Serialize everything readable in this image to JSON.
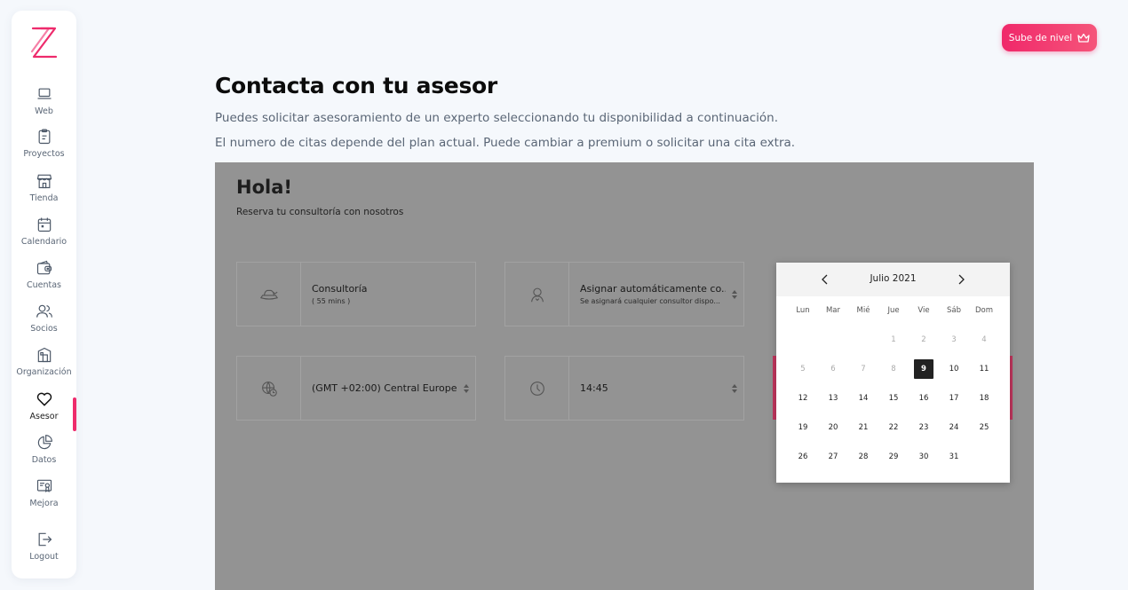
{
  "sidebar": {
    "items": [
      {
        "label": "Web",
        "icon": "laptop-icon"
      },
      {
        "label": "Proyectos",
        "icon": "clipboard-icon"
      },
      {
        "label": "Tienda",
        "icon": "store-icon"
      },
      {
        "label": "Calendario",
        "icon": "calendar-icon"
      },
      {
        "label": "Cuentas",
        "icon": "wallet-icon"
      },
      {
        "label": "Socios",
        "icon": "users-icon"
      },
      {
        "label": "Organización",
        "icon": "building-icon"
      },
      {
        "label": "Asesor",
        "icon": "heart-icon"
      },
      {
        "label": "Datos",
        "icon": "pie-chart-icon"
      },
      {
        "label": "Mejora",
        "icon": "certificate-icon"
      },
      {
        "label": "Logout",
        "icon": "logout-icon"
      }
    ],
    "active": "Asesor",
    "accent_color": "#ee2b6c"
  },
  "upgrade_button": {
    "label": "Sube de nivel",
    "icon": "crown-icon"
  },
  "header": {
    "title": "Contacta con tu asesor",
    "description_1": "Puedes solicitar asesoramiento de un experto seleccionando tu disponibilidad a continuación.",
    "description_2": "El numero de citas depende del plan actual. Puede cambiar a premium o solicitar una cita extra."
  },
  "booking": {
    "greeting": "Hola!",
    "subtitle": "Reserva tu consultoría con nosotros",
    "service": {
      "title": "Consultoría",
      "duration": "( 55 mins )",
      "icon": "hat-icon"
    },
    "consultant": {
      "title": "Asignar automáticamente co...",
      "subtitle": "Se asignará cualquier consultor dispo...",
      "icon": "person-icon"
    },
    "timezone": {
      "value": "(GMT +02:00) Central Europea...",
      "icon": "globe-clock-icon"
    },
    "time": {
      "value": "14:45",
      "icon": "clock-icon"
    }
  },
  "datepicker": {
    "month_label": "Julio 2021",
    "weekdays": [
      "Lun",
      "Mar",
      "Mié",
      "Jue",
      "Vie",
      "Sáb",
      "Dom"
    ],
    "weeks": [
      [
        "",
        "",
        "",
        "1",
        "2",
        "3",
        "4"
      ],
      [
        "5",
        "6",
        "7",
        "8",
        "9",
        "10",
        "11"
      ],
      [
        "12",
        "13",
        "14",
        "15",
        "16",
        "17",
        "18"
      ],
      [
        "19",
        "20",
        "21",
        "22",
        "23",
        "24",
        "25"
      ],
      [
        "26",
        "27",
        "28",
        "29",
        "30",
        "31",
        ""
      ]
    ],
    "disabled_days": [
      "1",
      "2",
      "3",
      "4",
      "5",
      "6",
      "7",
      "8"
    ],
    "selected_day": "9"
  }
}
